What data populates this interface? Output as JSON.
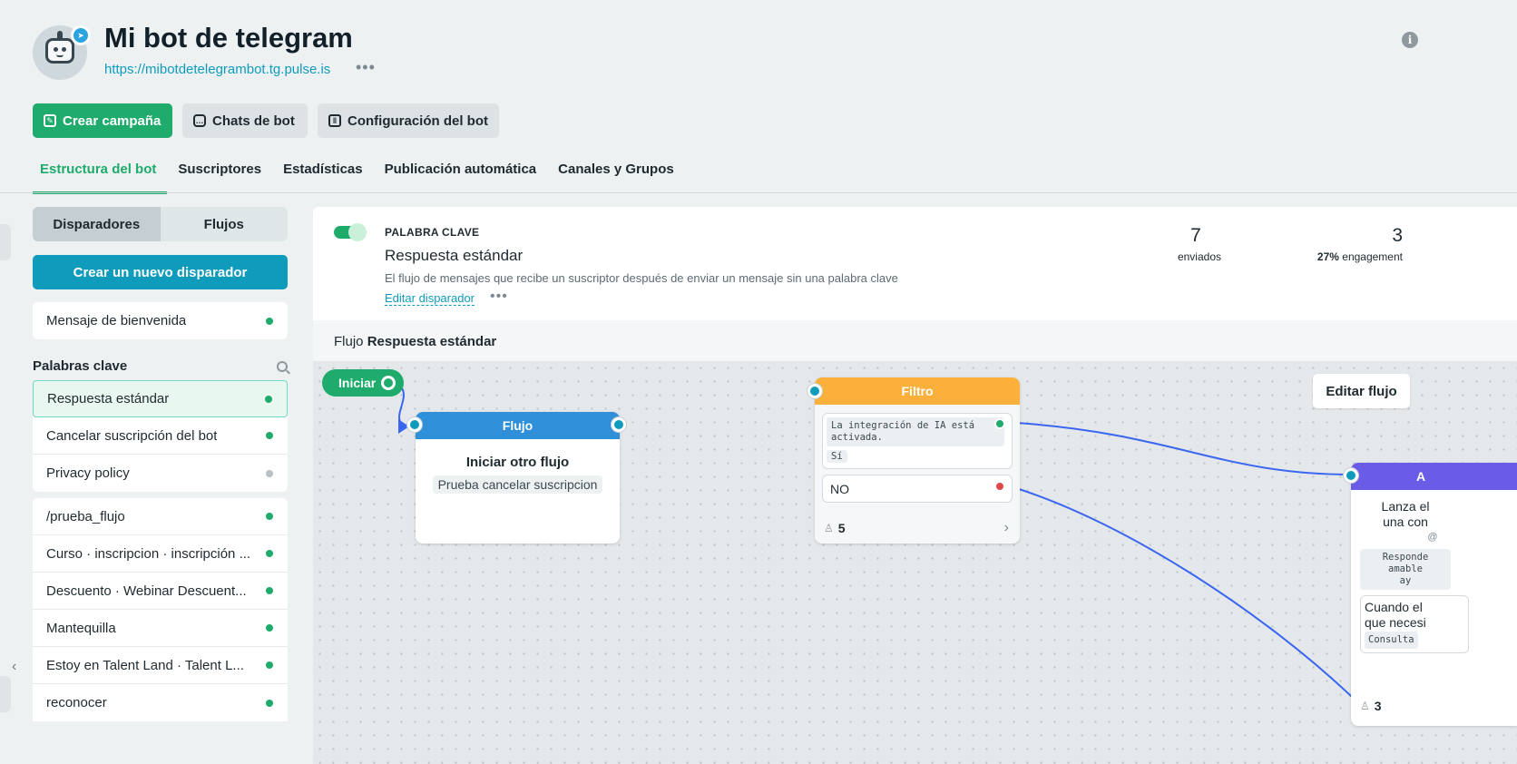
{
  "header": {
    "title": "Mi bot de telegram",
    "url": "https://mibotdetelegrambot.tg.pulse.is",
    "more": "•••",
    "info_icon": "info-icon",
    "avatar_icon": "robot-icon",
    "badge_icon": "telegram-icon"
  },
  "actions": {
    "create_campaign": "Crear campaña",
    "bot_chats": "Chats de bot",
    "bot_config": "Configuración del bot"
  },
  "tabs": [
    {
      "label": "Estructura del bot",
      "active": true
    },
    {
      "label": "Suscriptores"
    },
    {
      "label": "Estadísticas"
    },
    {
      "label": "Publicación automática"
    },
    {
      "label": "Canales y Grupos"
    }
  ],
  "sidebar": {
    "segment": {
      "triggers": "Disparadores",
      "flows": "Flujos"
    },
    "create_trigger": "Crear un nuevo disparador",
    "welcome": "Mensaje de bienvenida",
    "keywords_title": "Palabras clave",
    "keywords": [
      {
        "label": "Respuesta estándar",
        "status": "green"
      },
      {
        "label": "Cancelar suscripción del bot",
        "status": "green"
      },
      {
        "label": "Privacy policy",
        "status": "grey"
      }
    ],
    "commands": [
      {
        "label": "/prueba_flujo",
        "status": "green"
      },
      {
        "label": "Curso · inscripcion · inscripción ...",
        "status": "green"
      },
      {
        "label": "Descuento · Webinar Descuent...",
        "status": "green"
      },
      {
        "label": "Mantequilla",
        "status": "green"
      },
      {
        "label": "Estoy en Talent Land · Talent L...",
        "status": "green"
      },
      {
        "label": "reconocer",
        "status": "green"
      }
    ]
  },
  "trigger": {
    "type": "PALABRA CLAVE",
    "name": "Respuesta estándar",
    "description": "El flujo de mensajes que recibe un suscriptor después de enviar un mensaje sin una palabra clave",
    "edit": "Editar disparador",
    "more": "•••",
    "sent_value": "7",
    "sent_label": "enviados",
    "engagement_value": "3",
    "engagement_pct": "27%",
    "engagement_label": "engagement"
  },
  "flow": {
    "prefix": "Flujo",
    "name": "Respuesta estándar",
    "edit_flow": "Editar flujo",
    "start": "Iniciar",
    "flow_node": {
      "title": "Flujo",
      "subtitle": "Iniciar otro flujo",
      "target": "Prueba cancelar suscripcion",
      "color": "#2f8fd8"
    },
    "filter_node": {
      "title": "Filtro",
      "condition": "La integración de IA está activada.",
      "yes": "Sí",
      "no": "NO",
      "count": "5",
      "color": "#fbb03b"
    },
    "ai_node": {
      "title": "A",
      "line1": "Lanza el",
      "line2": "una con",
      "extra": "@",
      "code1": "Responde",
      "code2": "amable",
      "code3": "ay",
      "text1": "Cuando el",
      "text2": "que necesi",
      "code4": "Consulta",
      "count": "3",
      "color": "#6b5ce7"
    }
  },
  "colors": {
    "green": "#1fab6c",
    "teal": "#0f9cbc"
  }
}
